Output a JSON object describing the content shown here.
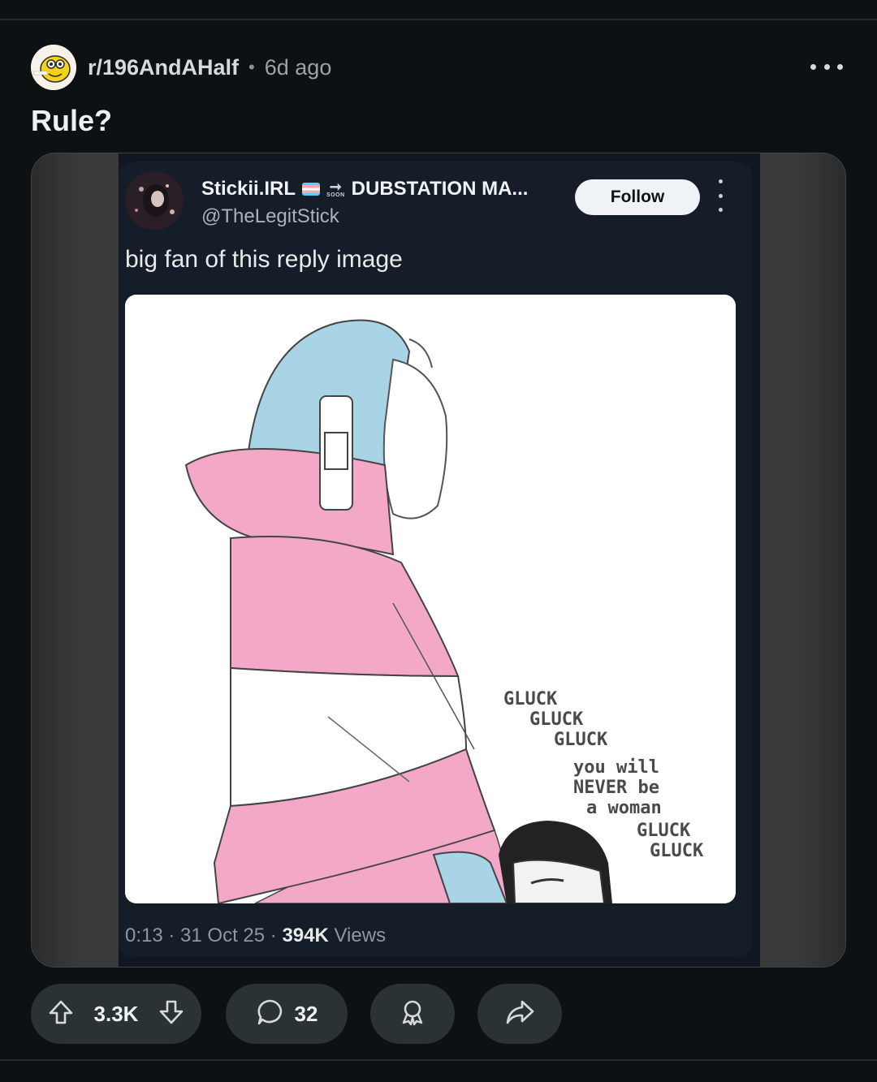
{
  "post": {
    "subreddit": "r/196AndAHalf",
    "separator": "•",
    "time_ago": "6d ago",
    "title": "Rule?"
  },
  "tweet": {
    "display_name": "Stickii.IRL",
    "display_name_suffix": "DUBSTATION MA...",
    "soon_label": "SOON",
    "arrow": "➞",
    "handle": "@TheLegitStick",
    "follow_label": "Follow",
    "text": "big fan of this reply image",
    "meta_prefix": "0:13 · 31 Oct 25 · ",
    "views_count": "394K",
    "views_label": " Views"
  },
  "comic": {
    "lines_top": [
      "GLUCK",
      "GLUCK",
      "GLUCK"
    ],
    "lines_mid": [
      "you will",
      "NEVER be",
      "a woman"
    ],
    "lines_bottom": [
      "GLUCK",
      "GLUCK"
    ]
  },
  "actions": {
    "upvotes": "3.3K",
    "comments": "32"
  },
  "colors": {
    "background": "#0e1113",
    "pill": "#2a3236",
    "trans_blue": "#5bcefa",
    "trans_pink": "#f5a9b8"
  }
}
